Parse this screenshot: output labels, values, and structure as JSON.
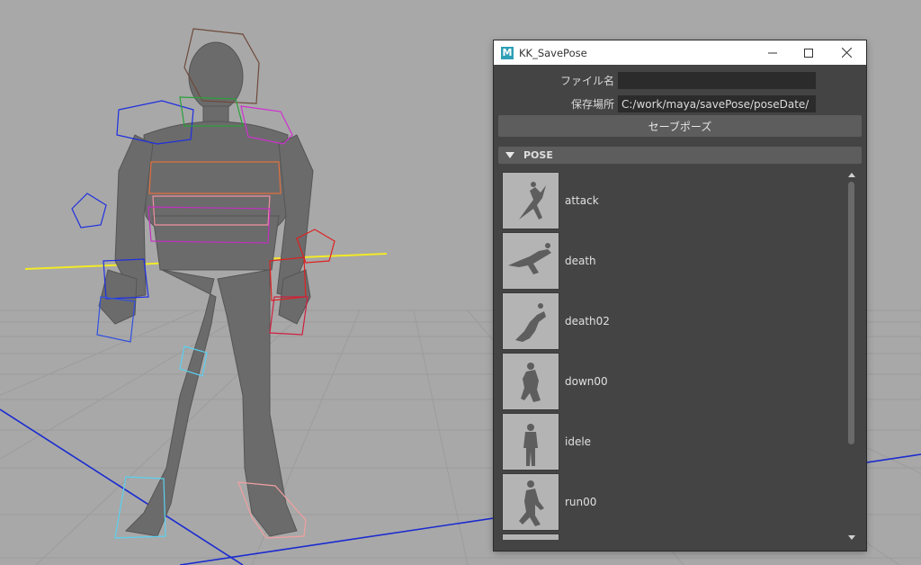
{
  "window": {
    "title": "KK_SavePose",
    "app_icon_letter": "M",
    "controls": {
      "minimize": "minimize",
      "maximize": "maximize",
      "close": "close"
    }
  },
  "form": {
    "filename_label": "ファイル名",
    "filename_value": "",
    "save_path_label": "保存場所",
    "save_path_value": "C:/work/maya/savePose/poseDate/",
    "save_button_label": "セーブポーズ"
  },
  "pose_section": {
    "header": "POSE",
    "items": [
      {
        "label": "attack"
      },
      {
        "label": "death"
      },
      {
        "label": "death02"
      },
      {
        "label": "down00"
      },
      {
        "label": "idele"
      },
      {
        "label": "run00"
      }
    ]
  },
  "colors": {
    "viewport_bg": "#a8a8a8",
    "panel_bg": "#444444",
    "accent_teal": "#2e9fb6"
  },
  "icons": [
    "maya-app-icon",
    "minimize-icon",
    "maximize-icon",
    "close-icon",
    "collapse-triangle-icon",
    "scroll-up-icon",
    "scroll-down-icon"
  ]
}
